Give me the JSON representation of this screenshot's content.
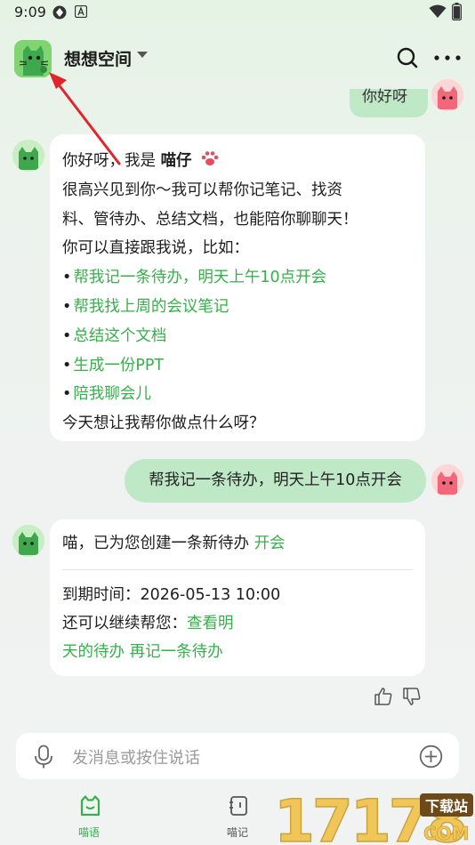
{
  "status_bar": {
    "time": "9:09"
  },
  "header": {
    "title": "想想空间"
  },
  "messages": {
    "user_first": "你好呀",
    "bot_intro": {
      "greeting": "你好呀，我是 ",
      "bot_name": "喵仔",
      "line2": "很高兴见到你～我可以帮你记笔记、找资",
      "line3": "料、管待办、总结文档，也能陪你聊聊天！",
      "line4": "你可以直接跟我说，比如：",
      "suggestions": [
        "帮我记一条待办，明天上午10点开会",
        "帮我找上周的会议笔记",
        "总结这个文档",
        "生成一份PPT",
        "陪我聊会儿"
      ],
      "closing": "今天想让我帮你做点什么呀？"
    },
    "user_second": "帮我记一条待办，明天上午10点开会",
    "bot_reply": {
      "text": "喵，已为您创建一条新待办 ",
      "todo_link": "开会",
      "due_label": "到期时间：",
      "due_value": "2026-05-13 10:00",
      "continue_label": "还可以继续帮您：",
      "action_view_1": "查看明",
      "action_view_2": "天的待办",
      "action_new": "再记一条待办"
    }
  },
  "input": {
    "placeholder": "发消息或按住说话"
  },
  "nav": {
    "items": [
      {
        "label": "喵语"
      },
      {
        "label": "喵记"
      }
    ]
  },
  "watermark": {
    "digits": "17178",
    "top": "下载站",
    "bottom": "COM"
  },
  "colors": {
    "accent": "#35b04a",
    "user_bubble": "#bfe8c7",
    "arrow": "#e0262b"
  }
}
